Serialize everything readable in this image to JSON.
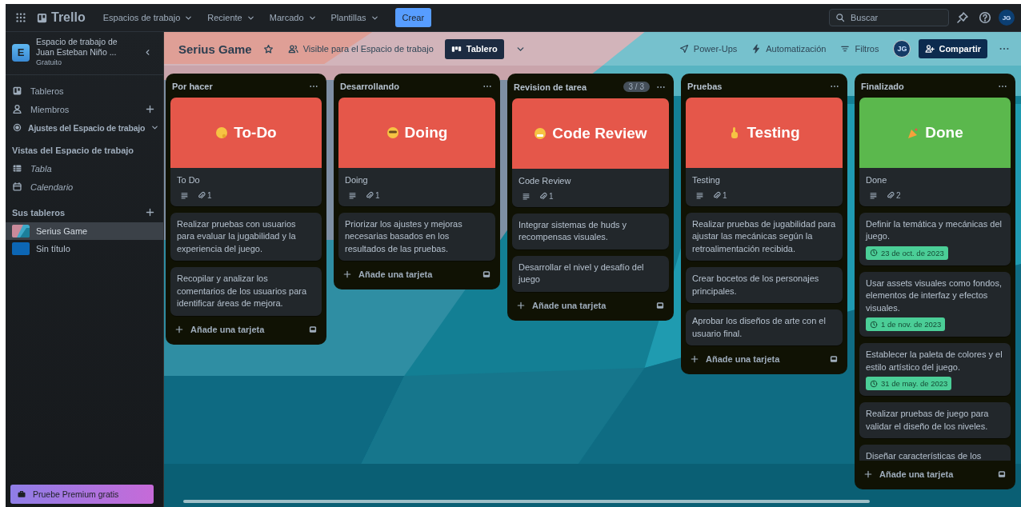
{
  "topbar": {
    "logo": "Trello",
    "menus": [
      "Espacios de trabajo",
      "Reciente",
      "Marcado",
      "Plantillas"
    ],
    "create": "Crear",
    "search": {
      "placeholder": "Buscar"
    },
    "avatar": "JG"
  },
  "sidebar": {
    "workspace": {
      "initial": "E",
      "name": "Espacio de trabajo de Juan Esteban Niño ...",
      "plan": "Gratuito"
    },
    "nav": [
      {
        "label": "Tableros",
        "kind": "link"
      },
      {
        "label": "Miembros",
        "kind": "add"
      },
      {
        "label": "Ajustes del Espacio de trabajo",
        "kind": "expand"
      }
    ],
    "views_heading": "Vistas del Espacio de trabajo",
    "views": [
      {
        "label": "Tabla"
      },
      {
        "label": "Calendario"
      }
    ],
    "boards_heading": "Sus tableros",
    "boards": [
      {
        "name": "Serius Game",
        "selected": true
      },
      {
        "name": "Sin título",
        "selected": false,
        "kind": "color",
        "color": "#0c66b4"
      }
    ],
    "premium": "Pruebe Premium gratis"
  },
  "board": {
    "title": "Serius Game",
    "visibility": "Visible para el Espacio de trabajo",
    "view": "Tablero",
    "actions": [
      "Power-Ups",
      "Automatización",
      "Filtros"
    ],
    "member": "JG",
    "share": "Compartir"
  },
  "lists": [
    {
      "title": "Por hacer",
      "add": "Añade una tarjeta",
      "cards": [
        {
          "kind": "cover",
          "color": "#e5574a",
          "cover_title": "To-Do",
          "title": "To Do",
          "attachments": "1"
        },
        {
          "kind": "text",
          "text": "Realizar pruebas con usuarios para evaluar la jugabilidad y la experiencia del juego."
        },
        {
          "kind": "text",
          "text": "Recopilar y analizar los comentarios de los usuarios para identificar áreas de mejora."
        }
      ]
    },
    {
      "title": "Desarrollando",
      "add": "Añade una tarjeta",
      "cards": [
        {
          "kind": "cover",
          "color": "#e5574a",
          "cover_title": "Doing",
          "title": "Doing",
          "attachments": "1"
        },
        {
          "kind": "text",
          "text": "Priorizar los ajustes y mejoras necesarias basados en los resultados de las pruebas."
        }
      ]
    },
    {
      "title": "Revision de tarea",
      "badge": "3 / 3",
      "add": "Añade una tarjeta",
      "cards": [
        {
          "kind": "cover",
          "color": "#e5574a",
          "cover_title": "Code Review",
          "title": "Code Review",
          "attachments": "1"
        },
        {
          "kind": "text",
          "text": "Integrar sistemas de huds y recompensas visuales."
        },
        {
          "kind": "text",
          "text": "Desarrollar el nivel y desafío del juego"
        }
      ]
    },
    {
      "title": "Pruebas",
      "add": "Añade una tarjeta",
      "cards": [
        {
          "kind": "cover",
          "color": "#e5574a",
          "cover_title": "Testing",
          "title": "Testing",
          "attachments": "1"
        },
        {
          "kind": "text",
          "text": "Realizar pruebas de jugabilidad para ajustar las mecánicas según la retroalimentación recibida."
        },
        {
          "kind": "text",
          "text": "Crear bocetos de los personajes principales."
        },
        {
          "kind": "text",
          "text": "Aprobar los diseños de arte con el usuario final."
        }
      ]
    },
    {
      "title": "Finalizado",
      "add": "Añade una tarjeta",
      "cards": [
        {
          "kind": "cover",
          "color": "#5bb84d",
          "cover_title": "Done",
          "title": "Done",
          "attachments": "2"
        },
        {
          "kind": "text",
          "text": "Definir la temática y mecánicas del juego.",
          "due": "23 de oct. de 2023"
        },
        {
          "kind": "text",
          "text": "Usar assets visuales como fondos, elementos de interfaz y efectos visuales.",
          "due": "1 de nov. de 2023"
        },
        {
          "kind": "text",
          "text": "Establecer la paleta de colores y el estilo artístico del juego.",
          "due": "31 de may. de 2023"
        },
        {
          "kind": "text",
          "text": "Realizar pruebas de juego para validar el diseño de los niveles."
        },
        {
          "kind": "text",
          "text": "Diseñar características de los"
        }
      ]
    }
  ]
}
